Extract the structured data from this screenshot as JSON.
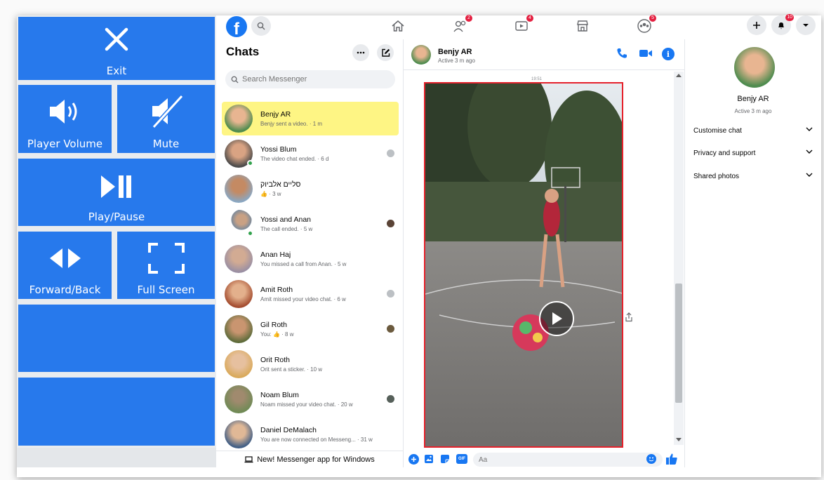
{
  "control_panel": {
    "exit_label": "Exit",
    "volume_label": "Player Volume",
    "mute_label": "Mute",
    "playpause_label": "Play/Pause",
    "forwardback_label": "Forward/Back",
    "fullscreen_label": "Full Screen"
  },
  "topbar": {
    "logo_letter": "f",
    "badges": {
      "friends": "2",
      "watch": "4",
      "groups": "5",
      "notifications": "10"
    }
  },
  "chats": {
    "title": "Chats",
    "search_placeholder": "Search Messenger",
    "items": [
      {
        "name": "Benjy AR",
        "sub": "Benjy sent a video. · 1 m",
        "selected": true
      },
      {
        "name": "Yossi Blum",
        "sub": "The video chat ended. · 6 d"
      },
      {
        "name": "סליים אלביוק",
        "sub": "👍 · 3 w"
      },
      {
        "name": "Yossi and Anan",
        "sub": "The call ended. · 5 w"
      },
      {
        "name": "Anan Haj",
        "sub": "You missed a call from Anan. · 5 w"
      },
      {
        "name": "Amit Roth",
        "sub": "Amit missed your video chat. · 6 w"
      },
      {
        "name": "Gil Roth",
        "sub": "You: 👍 · 8 w"
      },
      {
        "name": "Orit Roth",
        "sub": "Orit sent a sticker. · 10 w"
      },
      {
        "name": "Noam Blum",
        "sub": "Noam missed your video chat. · 20 w"
      },
      {
        "name": "Daniel DeMalach",
        "sub": "You are now connected on Messeng... · 31 w"
      }
    ],
    "footer": "New! Messenger app for Windows"
  },
  "conversation": {
    "name": "Benjy AR",
    "status": "Active 3 m ago",
    "time_label": "19:51",
    "composer_placeholder": "Aa"
  },
  "info": {
    "name": "Benjy AR",
    "status": "Active 3 m ago",
    "rows": [
      "Customise chat",
      "Privacy and support",
      "Shared photos"
    ]
  },
  "colors": {
    "accent": "#1877f2",
    "tile": "#2779ec",
    "highlight": "#fef584",
    "video_border": "#e5212b"
  }
}
